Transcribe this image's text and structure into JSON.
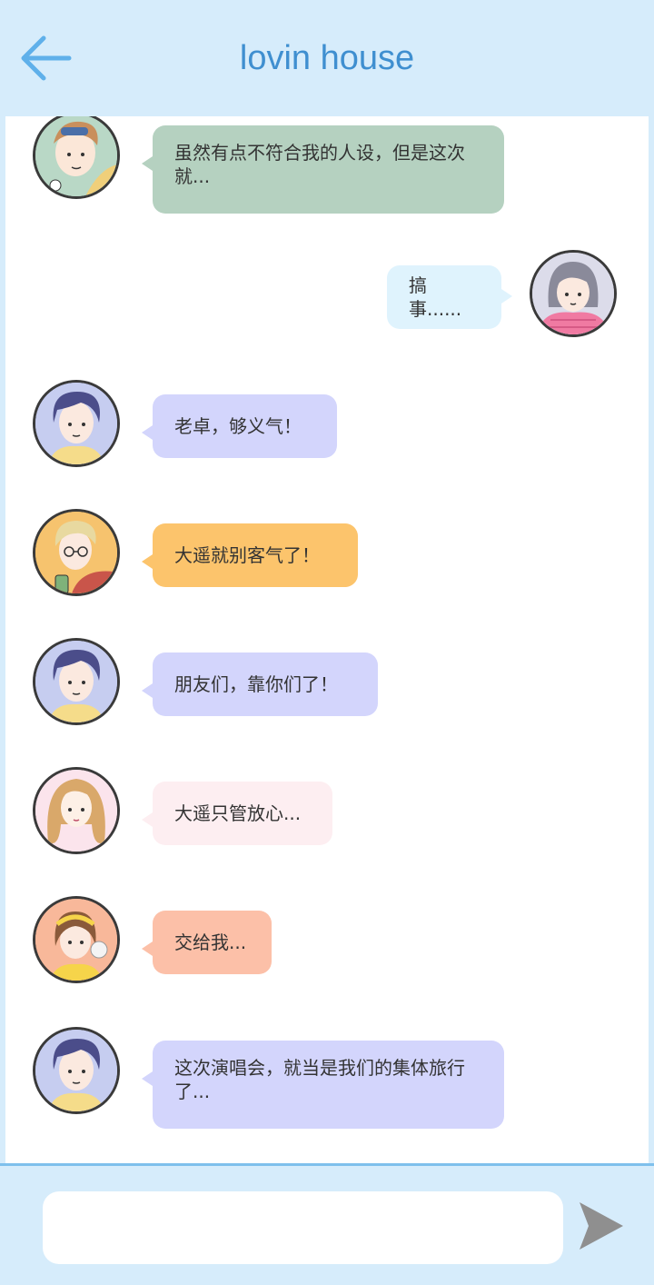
{
  "header": {
    "title": "lovin house"
  },
  "colors": {
    "header_bg": "#d6ecfb",
    "accent": "#3f8fd0",
    "bubble_green": "#b5d1c0",
    "bubble_blue_light": "#dff3fd",
    "bubble_lavender": "#d3d5fc",
    "bubble_orange": "#fcc46c",
    "bubble_pink": "#fdeef1",
    "bubble_salmon": "#fcc0a8"
  },
  "messages": [
    {
      "text": "虽然有点不符合我的人设，但是这次就...",
      "side": "left",
      "avatar": "boy-cap-avatar"
    },
    {
      "text": "搞事......",
      "side": "right",
      "avatar": "girl-scarf-avatar"
    },
    {
      "text": "老卓，够义气！",
      "side": "left",
      "avatar": "boy-dark-hair-avatar"
    },
    {
      "text": "大遥就别客气了！",
      "side": "left",
      "avatar": "boy-glasses-avatar"
    },
    {
      "text": "朋友们，靠你们了！",
      "side": "left",
      "avatar": "boy-dark-hair-avatar"
    },
    {
      "text": "大遥只管放心...",
      "side": "left",
      "avatar": "girl-wavy-hair-avatar"
    },
    {
      "text": "交给我...",
      "side": "left",
      "avatar": "girl-headband-avatar"
    },
    {
      "text": "这次演唱会，就当是我们的集体旅行了...",
      "side": "left",
      "avatar": "boy-dark-hair-avatar"
    }
  ],
  "composer": {
    "placeholder": "",
    "value": ""
  }
}
